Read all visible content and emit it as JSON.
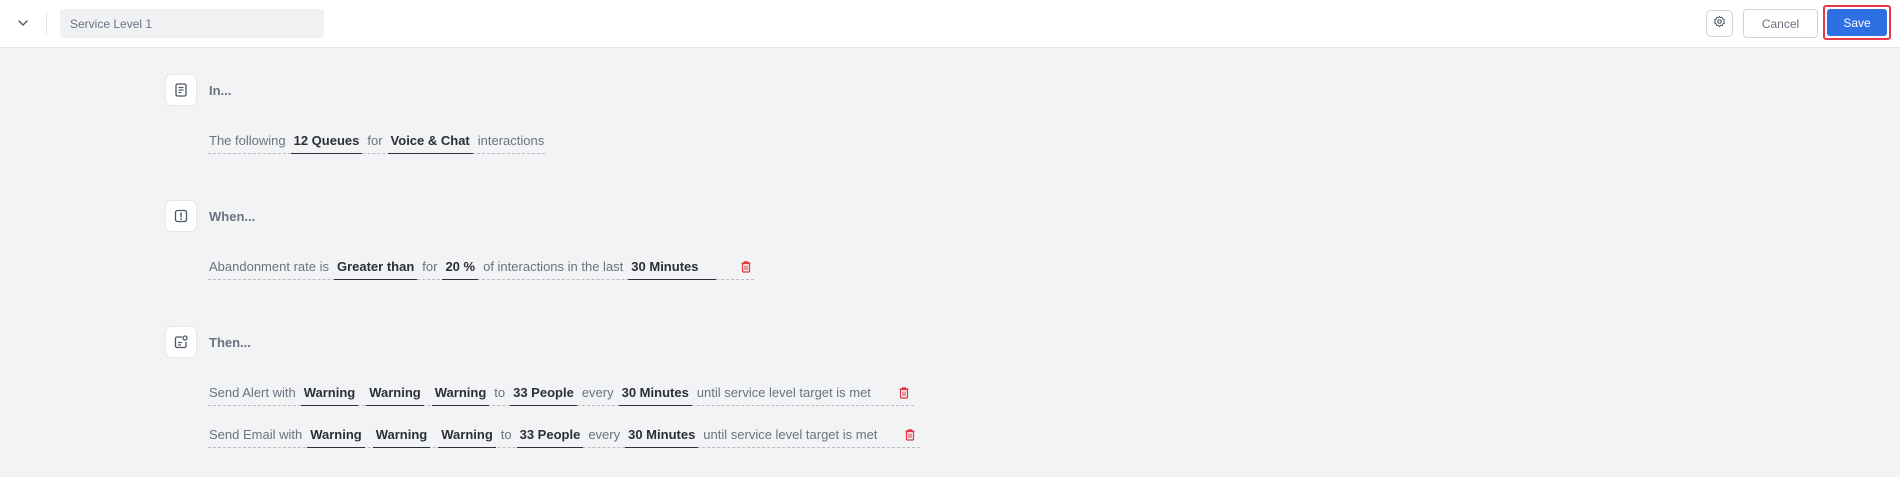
{
  "header": {
    "name_value": "Service Level 1",
    "cancel_label": "Cancel",
    "save_label": "Save"
  },
  "colors": {
    "accent": "#2f6fe4",
    "highlight": "#e8394a",
    "danger": "#e0353f"
  },
  "sections": {
    "in": {
      "title": "In...",
      "rule": {
        "t1": "The following",
        "queues": "12 Queues",
        "t2": "for",
        "channel": "Voice & Chat",
        "t3": "interactions"
      }
    },
    "when": {
      "title": "When...",
      "rule": {
        "t1": "Abandonment rate is",
        "op": "Greater than",
        "t2": "for",
        "pct": "20 %",
        "t3": "of interactions in the last",
        "period": "30 Minutes"
      }
    },
    "then": {
      "title": "Then...",
      "rules": [
        {
          "t1": "Send Alert with",
          "l1": "Warning",
          "l2": "Warning",
          "l3": "Warning",
          "t2": "to",
          "people": "33 People",
          "t3": "every",
          "period": "30 Minutes",
          "t4": "until service level target is met"
        },
        {
          "t1": "Send Email with",
          "l1": "Warning",
          "l2": "Warning",
          "l3": "Warning",
          "t2": "to",
          "people": "33 People",
          "t3": "every",
          "period": "30 Minutes",
          "t4": "until service level target is met"
        }
      ]
    }
  },
  "icons": {
    "collapse": "chevron-down-icon",
    "settings": "gear-icon",
    "in": "document-icon",
    "when": "alert-square-icon",
    "then": "notification-icon",
    "delete": "trash-icon"
  }
}
